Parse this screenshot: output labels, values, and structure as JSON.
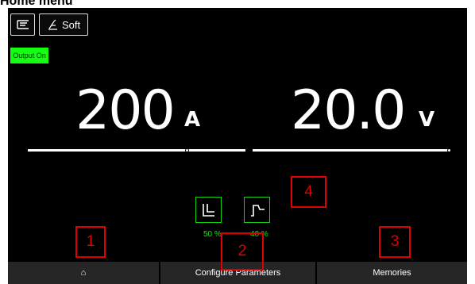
{
  "page": {
    "title": "Home menu"
  },
  "toolbar": {
    "process_icon": "welding-process-icon",
    "arc_icon": "torch-arc-icon",
    "arc_label": "Soft"
  },
  "status": {
    "output_label": "Output On",
    "output_color": "#12ff12"
  },
  "readings": {
    "current": {
      "value": "200",
      "unit": "A"
    },
    "voltage": {
      "value": "20.0",
      "unit": "V"
    }
  },
  "waveforms": {
    "left": {
      "icon": "waveform-step-down-icon",
      "percent": "50 %"
    },
    "right": {
      "icon": "waveform-pulse-icon",
      "percent": "40 %"
    },
    "accent_color": "#10d010"
  },
  "bottom_nav": {
    "home_icon": "⌂",
    "config_label": "Configure Parameters",
    "memories_label": "Memories"
  },
  "callouts": [
    "1",
    "2",
    "3",
    "4"
  ],
  "callout_color": "#e00000"
}
